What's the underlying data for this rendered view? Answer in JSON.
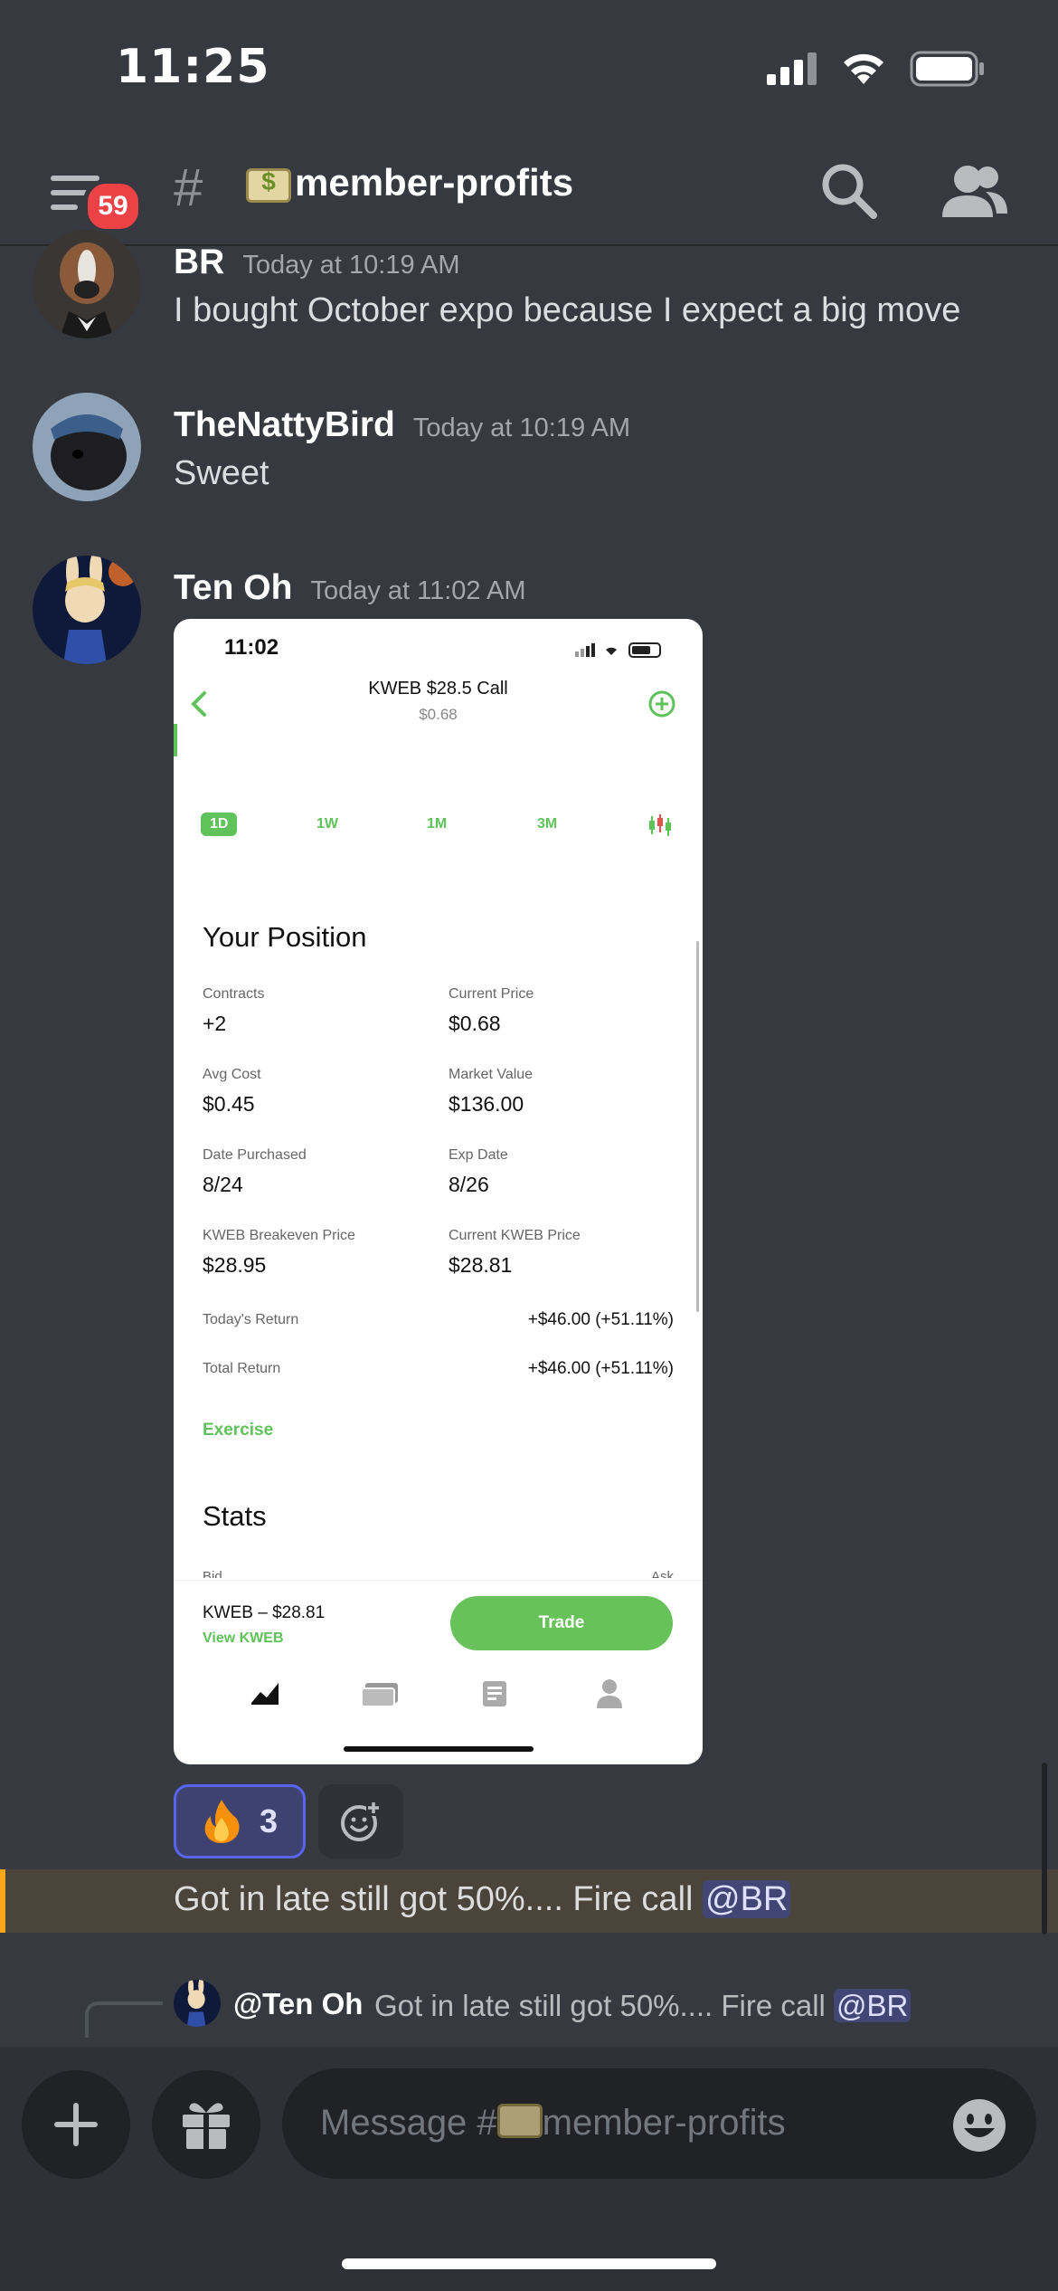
{
  "status": {
    "time": "11:25"
  },
  "header": {
    "badge_count": "59",
    "channel_name": "member-profits"
  },
  "messages": [
    {
      "author": "BR",
      "time": "Today at 10:19 AM",
      "text": "I bought October expo because I expect a big move"
    },
    {
      "author": "TheNattyBird",
      "time": "Today at 10:19 AM",
      "text": "Sweet"
    },
    {
      "author": "Ten Oh",
      "time": "Today at 11:02 AM"
    }
  ],
  "embedded_screenshot": {
    "time": "11:02",
    "title": "KWEB $28.5 Call",
    "subtitle": "$0.68",
    "ranges": [
      "1D",
      "1W",
      "1M",
      "3M"
    ],
    "position_heading": "Your Position",
    "fields": [
      {
        "label": "Contracts",
        "value": "+2"
      },
      {
        "label": "Current Price",
        "value": "$0.68"
      },
      {
        "label": "Avg Cost",
        "value": "$0.45"
      },
      {
        "label": "Market Value",
        "value": "$136.00"
      },
      {
        "label": "Date Purchased",
        "value": "8/24"
      },
      {
        "label": "Exp Date",
        "value": "8/26"
      },
      {
        "label": "KWEB Breakeven Price",
        "value": "$28.95"
      },
      {
        "label": "Current KWEB Price",
        "value": "$28.81"
      }
    ],
    "returns": [
      {
        "label": "Today's Return",
        "value": "+$46.00 (+51.11%)"
      },
      {
        "label": "Total Return",
        "value": "+$46.00 (+51.11%)"
      }
    ],
    "exercise": "Exercise",
    "stats_heading": "Stats",
    "stats_partial": {
      "left": "Bid",
      "right": "Ask"
    },
    "ticker": "KWEB – $28.81",
    "view_link": "View KWEB",
    "trade": "Trade"
  },
  "reactions": {
    "fire_count": "3"
  },
  "highlight": {
    "text": "Got in late still got 50%.... Fire call ",
    "mention": "@BR"
  },
  "reply": {
    "author": "@Ten Oh",
    "text": "Got in late still got 50%.... Fire call ",
    "mention": "@BR"
  },
  "composer": {
    "placeholder_prefix": "Message #",
    "placeholder_channel": "member-profits"
  },
  "colors": {
    "background": "#36393f",
    "accent": "#5865f2",
    "trade_green": "#67c25a",
    "mention_bg": "#414675",
    "highlight_bar": "#faa81a"
  }
}
